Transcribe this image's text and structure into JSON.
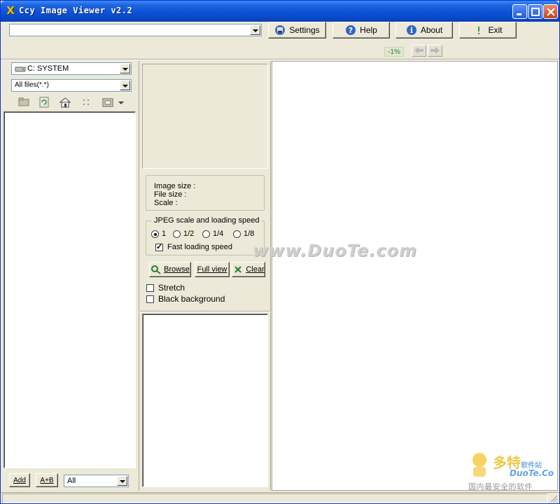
{
  "window": {
    "title": "Ccy Image Viewer v2.2"
  },
  "toolbar": {
    "path_value": "",
    "settings_label": "Settings",
    "help_label": "Help",
    "about_label": "About",
    "exit_label": "Exit",
    "zoom_readout": "-1%"
  },
  "left_panel": {
    "drive_value": "C: SYSTEM",
    "filter_value": "All files(*.*)",
    "tools": [
      "folder-up-icon",
      "refresh-icon",
      "home-icon",
      "view-list-icon",
      "thumbnail-menu-icon"
    ],
    "add_label": "Add",
    "add_b_label": "A+B",
    "list_filter_value": "All"
  },
  "info_panel": {
    "image_size_label": "Image size :",
    "file_size_label": "File size :",
    "scale_label": "Scale :"
  },
  "jpeg_group": {
    "title": "JPEG scale and loading speed",
    "options": [
      "1",
      "1/2",
      "1/4",
      "1/8"
    ],
    "selected": "1",
    "fast_loading_label": "Fast loading speed",
    "fast_loading_checked": true
  },
  "actions": {
    "browse_label": "Browse",
    "full_view_label": "Full view",
    "clear_label": "Clear"
  },
  "options": {
    "stretch_label": "Stretch",
    "stretch_checked": false,
    "black_bg_label": "Black background",
    "black_bg_checked": false
  },
  "watermarks": {
    "center": "www.DuoTe.com",
    "logo_line1": "多特",
    "logo_line1_small": "软件站",
    "logo_line2": "DuoTe.Co",
    "logo_line3": "国内最安全的软件"
  },
  "colors": {
    "title_bar": "#0a52d8",
    "face": "#ece9d8",
    "accent_zoom": "#3a9a3a"
  }
}
